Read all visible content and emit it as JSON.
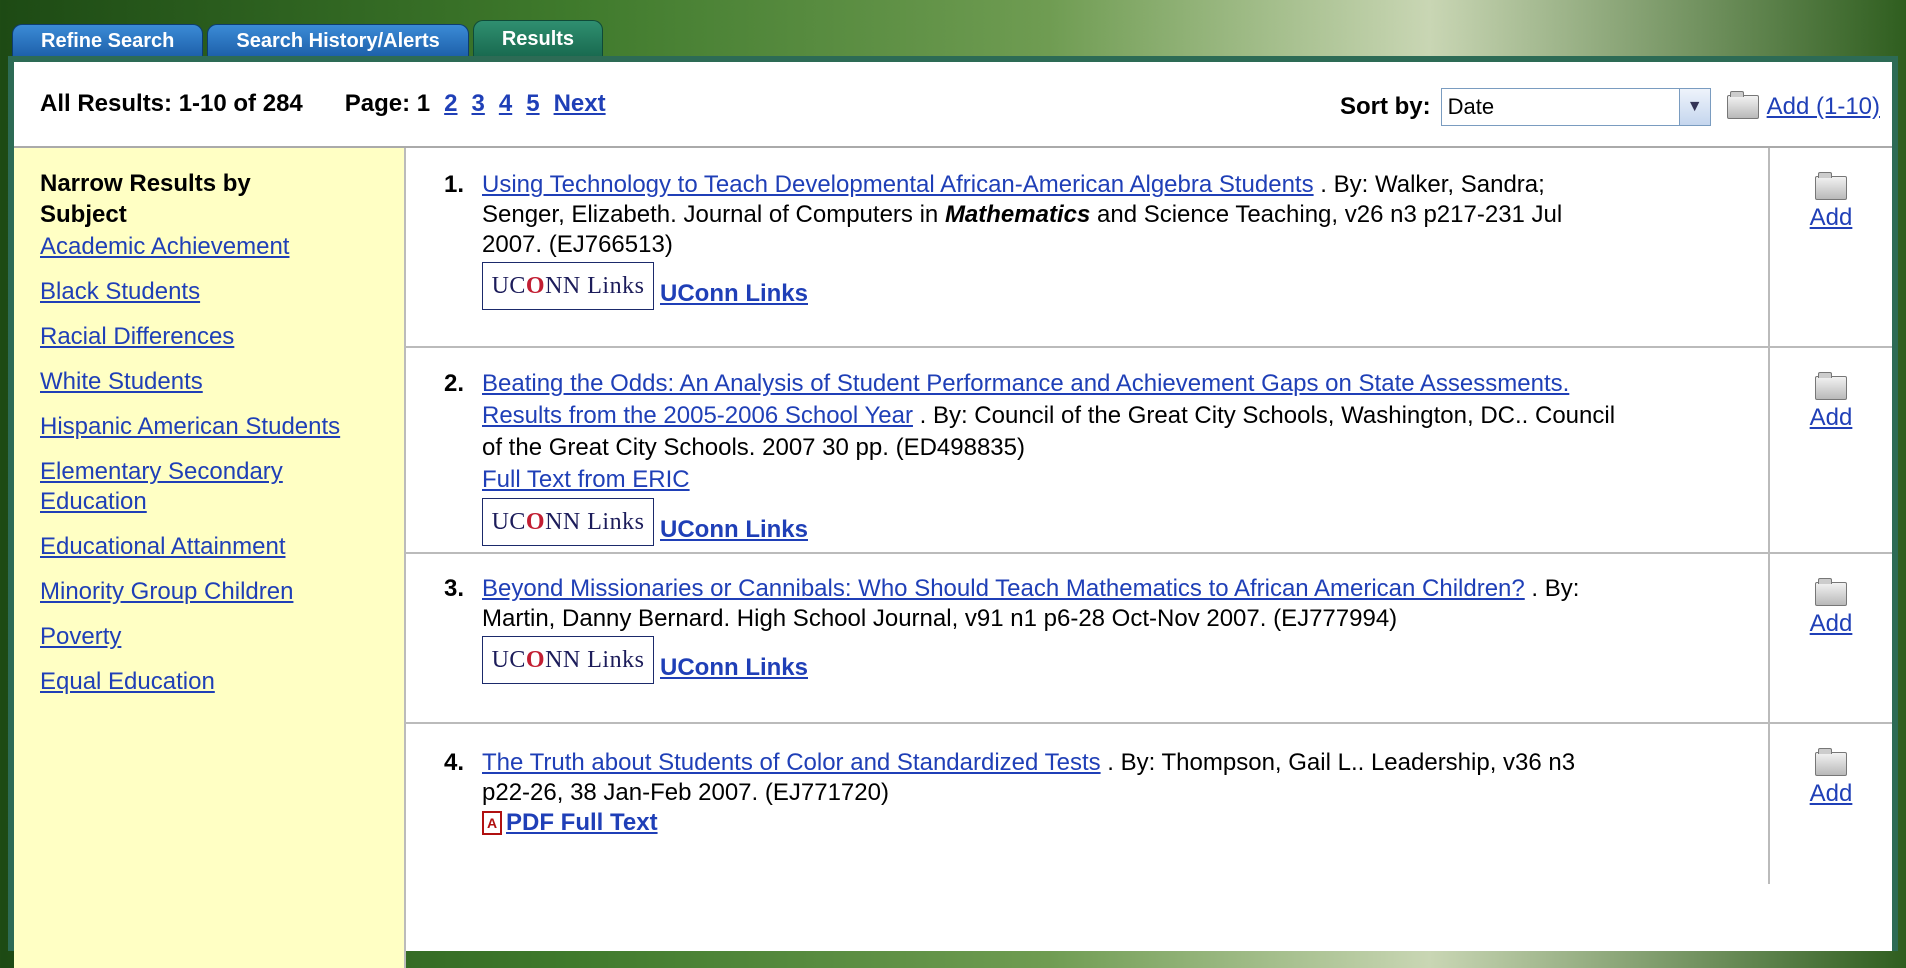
{
  "tabs": [
    {
      "label": "Refine Search"
    },
    {
      "label": "Search History/Alerts"
    },
    {
      "label": "Results"
    }
  ],
  "topbar": {
    "summary": "All Results: 1-10 of 284",
    "page_label": "Page: 1",
    "pages": [
      "2",
      "3",
      "4",
      "5"
    ],
    "next_label": "Next",
    "sort_label": "Sort by:",
    "sort_value": "Date",
    "add_all_label": "Add (1-10)"
  },
  "sidebar": {
    "title": "Narrow Results by Subject",
    "items": [
      "Academic Achievement",
      "Black Students",
      "Racial Differences",
      "White Students",
      "Hispanic American Students",
      "Elementary Secondary Education",
      "Educational Attainment",
      "Minority Group Children",
      "Poverty",
      "Equal Education"
    ]
  },
  "results": [
    {
      "num": "1.",
      "title": "Using Technology to Teach Developmental African-American Algebra Students",
      "pre": " . By: Walker, Sandra; Senger, Elizabeth. Journal of Computers in ",
      "emph": "Mathematics",
      "post": " and Science Teaching, v26 n3 p217-231 Jul 2007. (EJ766513)",
      "link_label": "UConn Links",
      "add_label": "Add"
    },
    {
      "num": "2.",
      "title": "Beating the Odds: An Analysis of Student Performance and Achievement Gaps on State Assessments. Results from the 2005-2006 School Year",
      "pre": " . By: Council of the Great City Schools, Washington, DC.. Council of the Great City Schools. 2007 30 pp. (ED498835)",
      "fulltext_label": "Full Text from ERIC",
      "link_label": "UConn Links",
      "add_label": "Add"
    },
    {
      "num": "3.",
      "title": "Beyond Missionaries or Cannibals: Who Should Teach Mathematics to African American Children?",
      "pre": " . By: Martin, Danny Bernard. High School Journal, v91 n1 p6-28 Oct-Nov 2007. (EJ777994)",
      "link_label": "UConn Links",
      "add_label": "Add"
    },
    {
      "num": "4.",
      "title": "The Truth about Students of Color and Standardized Tests",
      "pre": " . By: Thompson, Gail L.. Leadership, v36 n3 p22-26, 38 Jan-Feb 2007. (EJ771720)",
      "pdf_label": "PDF Full Text",
      "add_label": "Add"
    }
  ],
  "uconn_logo": {
    "text_pre": "UC",
    "text_o": "O",
    "text_post": "NN Links"
  }
}
